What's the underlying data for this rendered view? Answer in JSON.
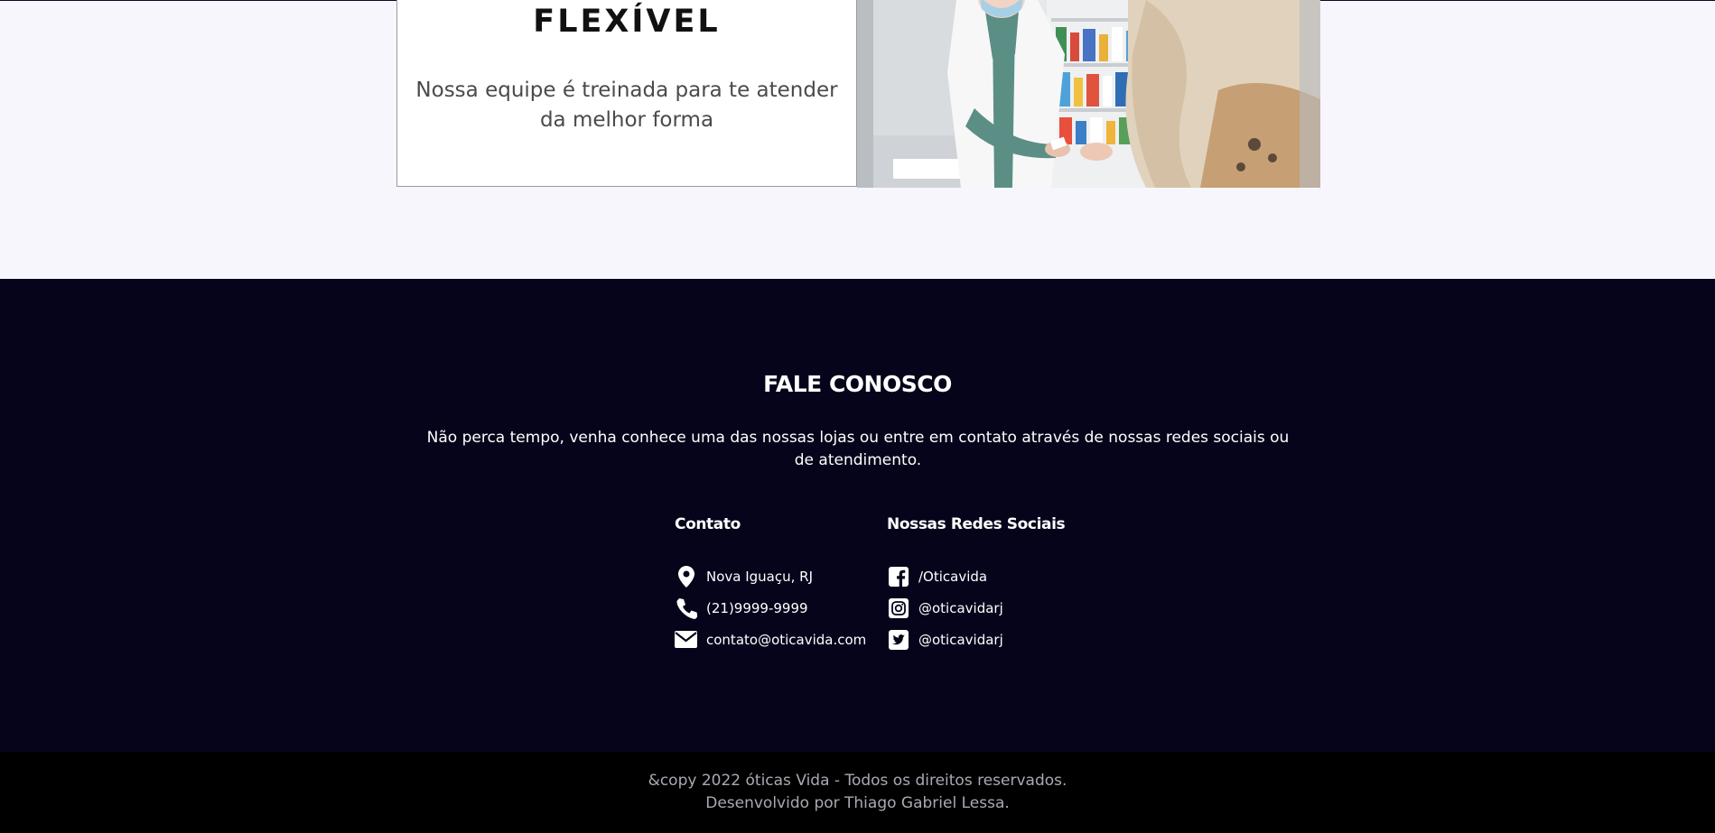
{
  "feature": {
    "title": "FLEXÍVEL",
    "description": "Nossa equipe é treinada para te atender da melhor forma"
  },
  "contact": {
    "title": "FALE CONOSCO",
    "description": "Não perca tempo, venha conhece uma das nossas lojas ou entre em contato através de nossas redes sociais ou de atendimento.",
    "contato": {
      "heading": "Contato",
      "items": [
        {
          "icon": "location-pin-icon",
          "text": "Nova Iguaçu, RJ"
        },
        {
          "icon": "phone-icon",
          "text": "(21)9999-9999"
        },
        {
          "icon": "envelope-icon",
          "text": "contato@oticavida.com"
        }
      ]
    },
    "redes": {
      "heading": "Nossas Redes Sociais",
      "items": [
        {
          "icon": "facebook-icon",
          "text": "/Oticavida"
        },
        {
          "icon": "instagram-icon",
          "text": "@oticavidarj"
        },
        {
          "icon": "twitter-icon",
          "text": "@oticavidarj"
        }
      ]
    }
  },
  "footer": {
    "copyright": "&copy 2022 óticas Vida - Todos os direitos reservados.",
    "developer": "Desenvolvido por Thiago Gabriel Lessa."
  },
  "colors": {
    "page_bg": "#f7f6fd",
    "contact_bg": "#05041b",
    "footer_bg": "#000000"
  }
}
